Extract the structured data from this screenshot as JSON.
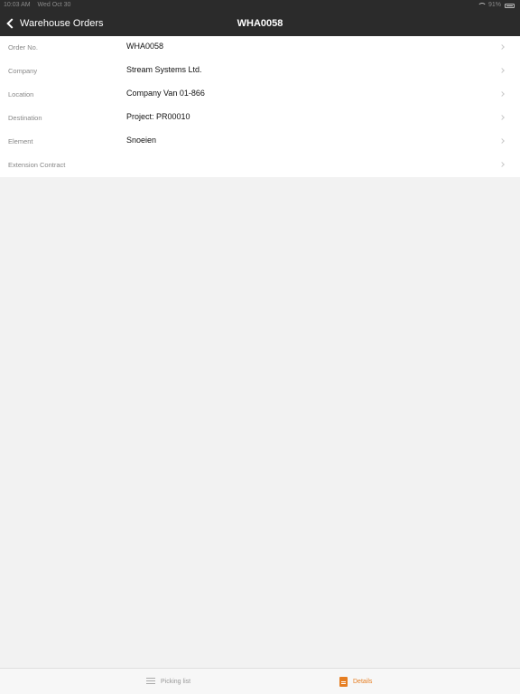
{
  "status_bar": {
    "time": "10:03 AM",
    "date": "Wed Oct 30",
    "battery": "91%"
  },
  "nav": {
    "back_label": "Warehouse Orders",
    "title": "WHA0058"
  },
  "details": [
    {
      "label": "Order No.",
      "value": "WHA0058"
    },
    {
      "label": "Company",
      "value": "Stream Systems Ltd."
    },
    {
      "label": "Location",
      "value": "Company Van 01-866"
    },
    {
      "label": "Destination",
      "value": "Project: PR00010"
    },
    {
      "label": "Element",
      "value": "Snoeien"
    },
    {
      "label": "Extension Contract",
      "value": ""
    }
  ],
  "tabs": [
    {
      "label": "Picking list",
      "icon": "list-icon",
      "active": false
    },
    {
      "label": "Details",
      "icon": "document-icon",
      "active": true
    }
  ],
  "colors": {
    "accent": "#e67e22",
    "nav_background": "#2b2b2b",
    "page_background": "#f2f2f2"
  }
}
